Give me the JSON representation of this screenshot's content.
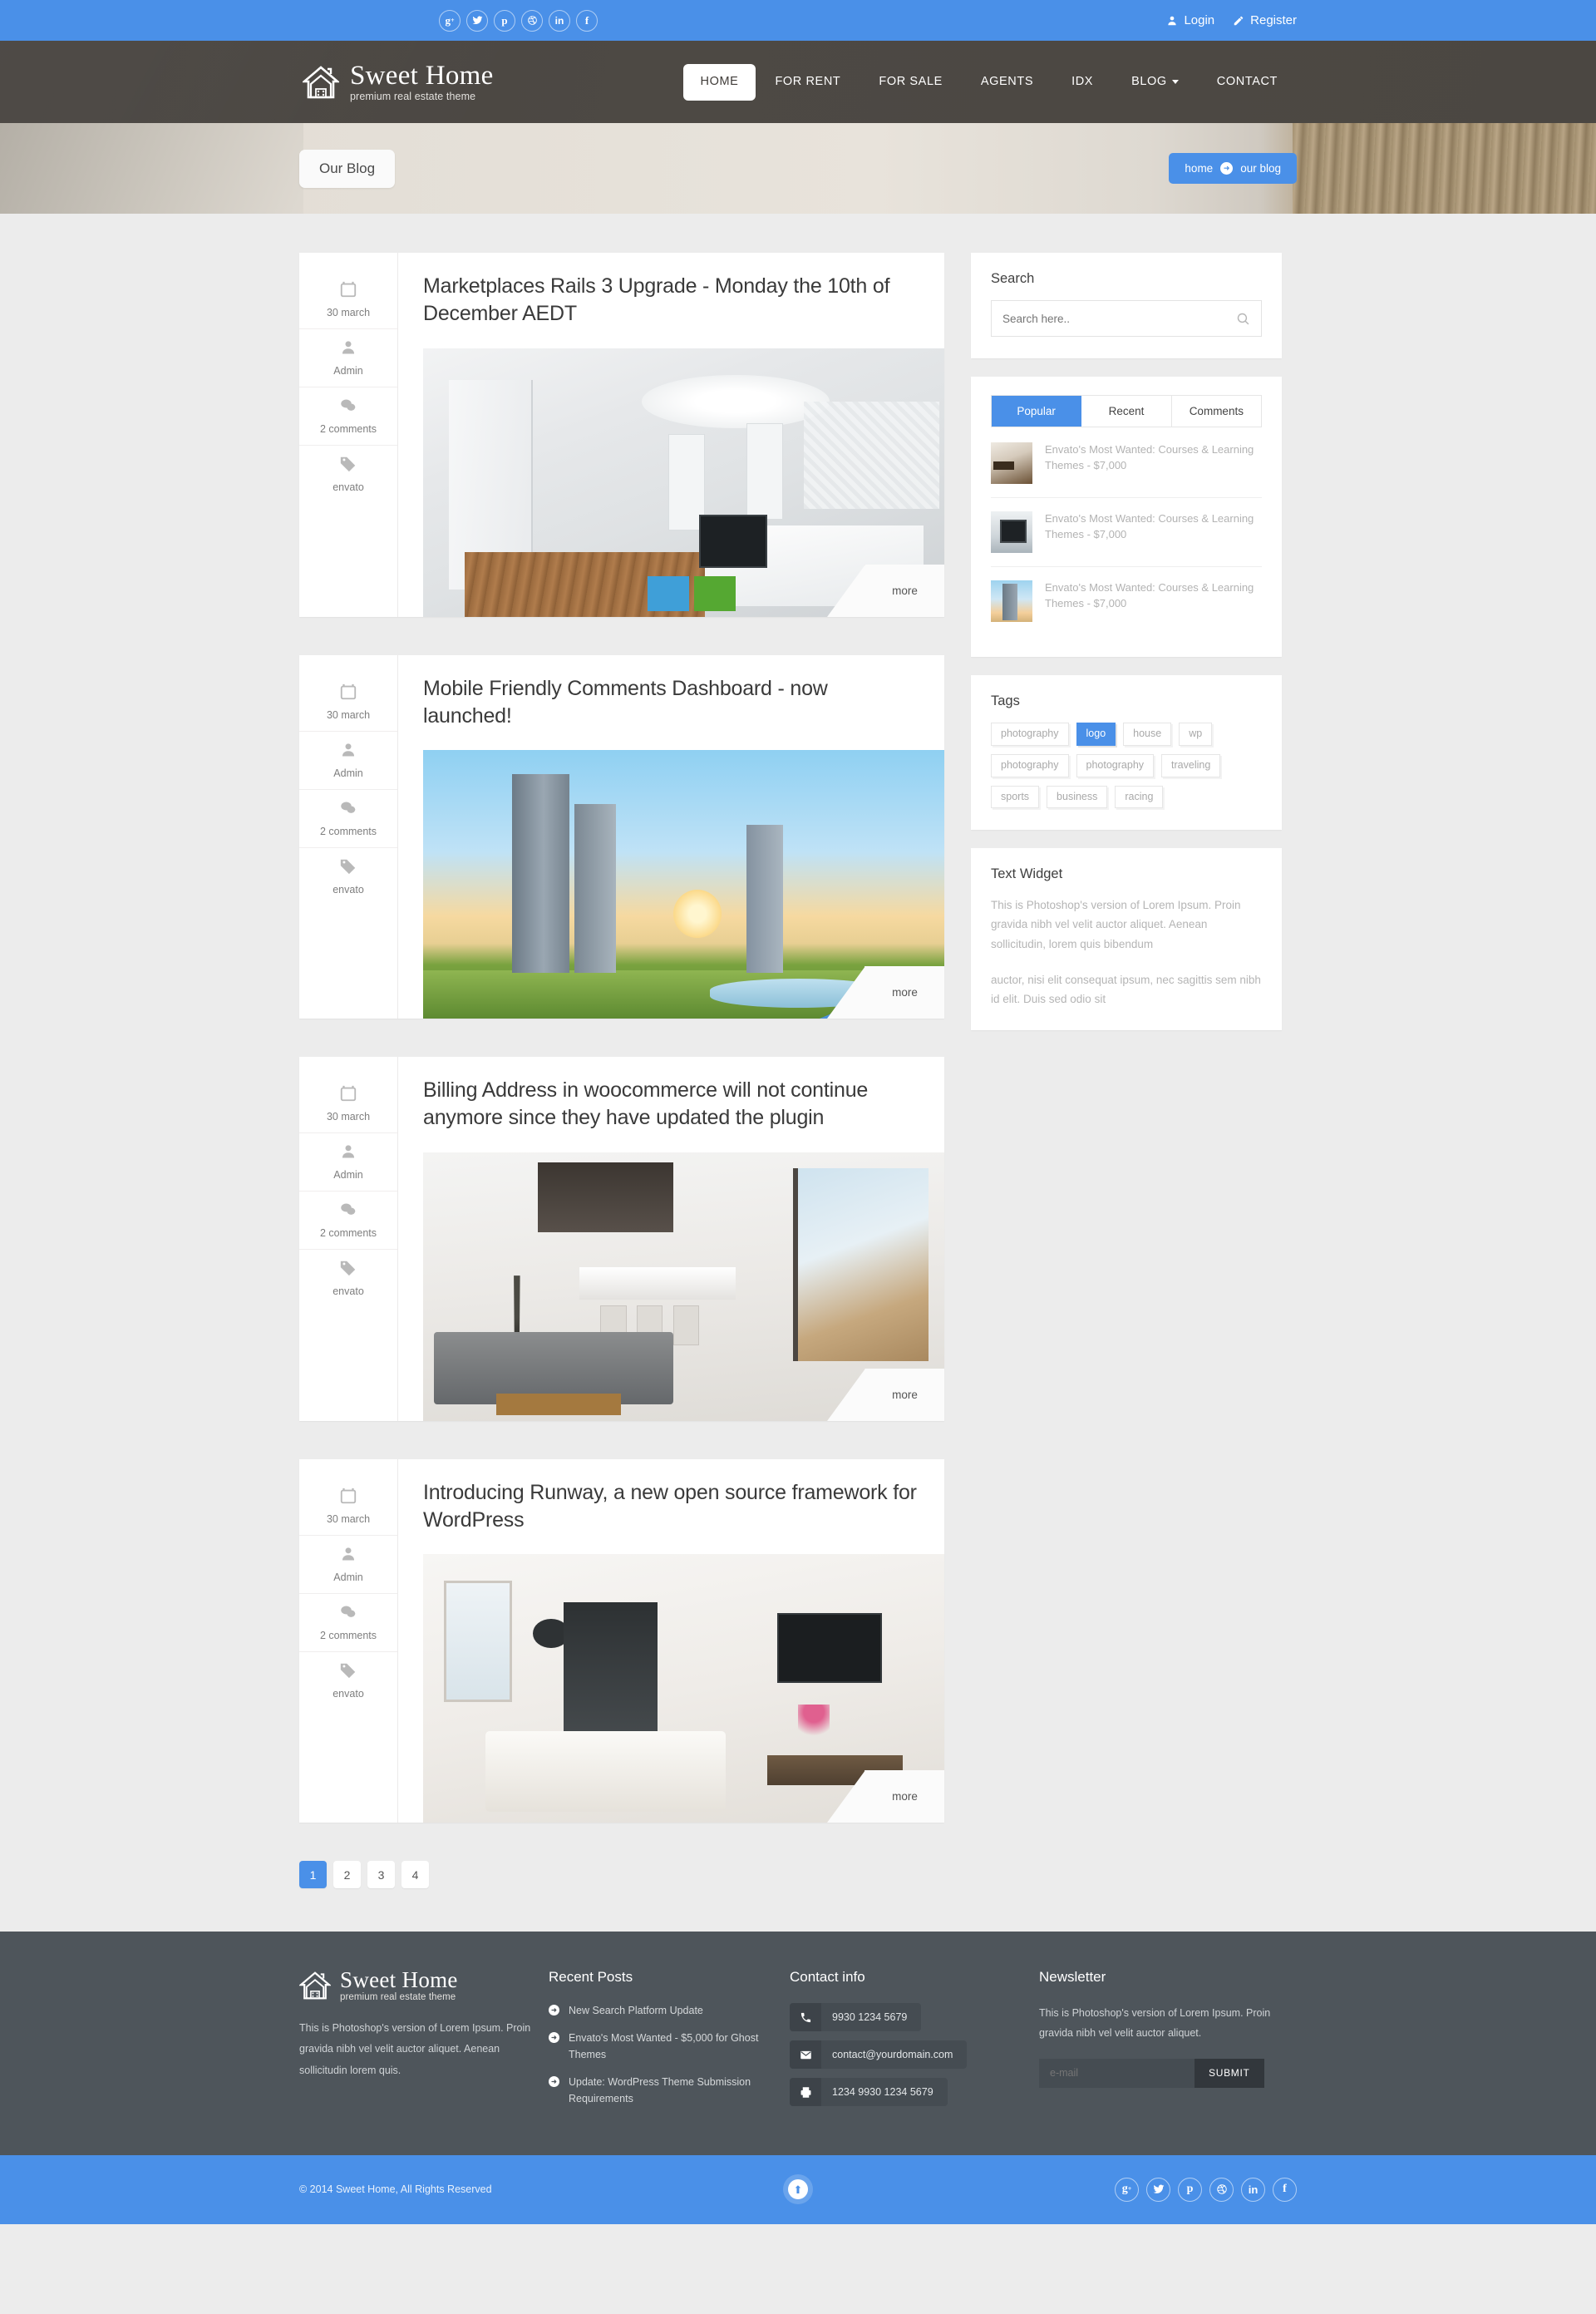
{
  "topbar": {
    "socials": [
      "g+",
      "twitter",
      "pinterest",
      "dribbble",
      "linkedin",
      "facebook"
    ],
    "login_label": "Login",
    "register_label": "Register"
  },
  "header": {
    "logo_name": "Sweet Home",
    "logo_tagline": "premium real estate theme",
    "nav": [
      {
        "label": "HOME",
        "active": true,
        "dropdown": false
      },
      {
        "label": "FOR RENT",
        "active": false,
        "dropdown": false
      },
      {
        "label": "FOR SALE",
        "active": false,
        "dropdown": false
      },
      {
        "label": "AGENTS",
        "active": false,
        "dropdown": false
      },
      {
        "label": "IDX",
        "active": false,
        "dropdown": false
      },
      {
        "label": "BLOG",
        "active": false,
        "dropdown": true
      },
      {
        "label": "CONTACT",
        "active": false,
        "dropdown": false
      }
    ]
  },
  "banner": {
    "page_title": "Our Blog",
    "breadcrumb_home": "home",
    "breadcrumb_current": "our blog"
  },
  "posts": [
    {
      "date": "30 march",
      "author": "Admin",
      "comments": "2 comments",
      "tag": "envato",
      "title": "Marketplaces Rails 3 Upgrade - Monday the 10th of December AEDT",
      "more_label": "more",
      "image": "bedroom-interior"
    },
    {
      "date": "30 march",
      "author": "Admin",
      "comments": "2 comments",
      "tag": "envato",
      "title": "Mobile Friendly Comments Dashboard - now launched!",
      "more_label": "more",
      "image": "city-skyline-sunset"
    },
    {
      "date": "30 march",
      "author": "Admin",
      "comments": "2 comments",
      "tag": "envato",
      "title": "Billing Address in woocommerce will not continue anymore since they have updated the plugin",
      "more_label": "more",
      "image": "kitchen-living-room"
    },
    {
      "date": "30 march",
      "author": "Admin",
      "comments": "2 comments",
      "tag": "envato",
      "title": "Introducing Runway, a new open source framework for WordPress",
      "more_label": "more",
      "image": "living-room-interior"
    }
  ],
  "pagination": {
    "pages": [
      "1",
      "2",
      "3",
      "4"
    ],
    "active": "1"
  },
  "sidebar": {
    "search": {
      "title": "Search",
      "placeholder": "Search here.."
    },
    "tabs_widget": {
      "tabs": [
        {
          "label": "Popular",
          "active": true
        },
        {
          "label": "Recent",
          "active": false
        },
        {
          "label": "Comments",
          "active": false
        }
      ],
      "items": [
        {
          "text": "Envato's Most Wanted: Courses & Learning Themes - $7,000",
          "thumb": "apartment-interior"
        },
        {
          "text": "Envato's Most Wanted: Courses & Learning Themes - $7,000",
          "thumb": "monitor-desk"
        },
        {
          "text": "Envato's Most Wanted: Courses & Learning Themes - $7,000",
          "thumb": "tower-building"
        }
      ]
    },
    "tags": {
      "title": "Tags",
      "items": [
        {
          "label": "photography",
          "active": false
        },
        {
          "label": "logo",
          "active": true
        },
        {
          "label": "house",
          "active": false
        },
        {
          "label": "wp",
          "active": false
        },
        {
          "label": "photography",
          "active": false
        },
        {
          "label": "photography",
          "active": false
        },
        {
          "label": "traveling",
          "active": false
        },
        {
          "label": "sports",
          "active": false
        },
        {
          "label": "business",
          "active": false
        },
        {
          "label": "racing",
          "active": false
        }
      ]
    },
    "text_widget": {
      "title": "Text Widget",
      "paragraph1": "This is Photoshop's version  of Lorem Ipsum. Proin gravida nibh vel velit auctor aliquet. Aenean sollicitudin, lorem quis bibendum",
      "paragraph2": " auctor, nisi elit consequat ipsum, nec sagittis sem nibh id elit. Duis sed odio sit"
    }
  },
  "footer": {
    "about": {
      "logo_name": "Sweet Home",
      "logo_tagline": "premium real estate theme",
      "description": "This is Photoshop's version  of Lorem Ipsum. Proin gravida nibh vel velit auctor aliquet. Aenean sollicitudin lorem quis."
    },
    "recent_posts": {
      "title": "Recent Posts",
      "items": [
        "New Search Platform Update",
        "Envato's Most Wanted - $5,000 for Ghost Themes",
        "Update: WordPress Theme Submission Requirements"
      ]
    },
    "contact": {
      "title": "Contact info",
      "phone": "9930 1234 5679",
      "email": "contact@yourdomain.com",
      "fax": "1234 9930 1234 5679"
    },
    "newsletter": {
      "title": "Newsletter",
      "description": "This is Photoshop's version  of Lorem Ipsum. Proin gravida nibh vel velit auctor aliquet.",
      "placeholder": "e-mail",
      "submit_label": "SUBMIT"
    }
  },
  "bottombar": {
    "copyright": "© 2014 Sweet Home,  All Rights Reserved",
    "socials": [
      "g+",
      "twitter",
      "pinterest",
      "dribbble",
      "linkedin",
      "facebook"
    ]
  },
  "colors": {
    "accent": "#4a90e8",
    "header_dark": "#4b4742",
    "footer": "#4e555b",
    "page_bg": "#ececec"
  }
}
